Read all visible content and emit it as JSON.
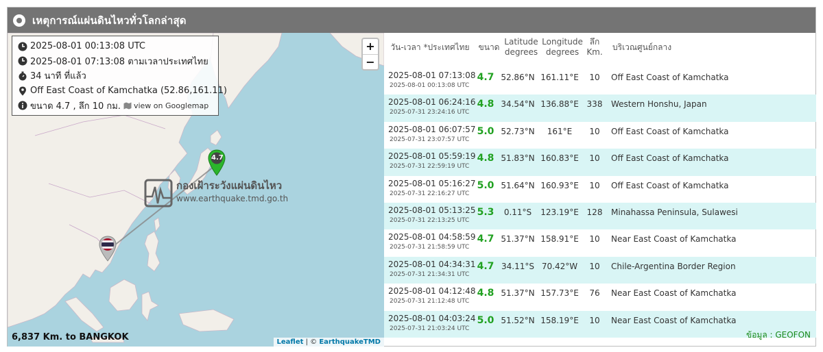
{
  "header": {
    "title": "เหตุการณ์แผ่นดินไหวทั่วโลกล่าสุด"
  },
  "info": {
    "utc": "2025-08-01 00:13:08 UTC",
    "thai_time": "2025-08-01 07:13:08 ตามเวลาประเทศไทย",
    "ago": "34 นาที ที่แล้ว",
    "location": "Off East Coast of Kamchatka (52.86,161.11)",
    "magnitude_depth": "ขนาด 4.7 , ลึก 10 กม.",
    "googlemap_link": "view on Googlemap"
  },
  "map": {
    "zoom_in": "+",
    "zoom_out": "−",
    "marker_mag": "4.7",
    "watermark_title": "กองเฝ้าระวังแผ่นดินไหว",
    "watermark_url": "www.earthquake.tmd.go.th",
    "distance": "6,837 Km. to BANGKOK",
    "attribution_leaflet": "Leaflet",
    "attribution_sep": " | © ",
    "attribution_tmd": "EarthquakeTMD"
  },
  "table": {
    "headers": {
      "datetime": "วัน-เวลา *ประเทศไทย",
      "magnitude": "ขนาด",
      "latitude": "Latitude degrees",
      "longitude": "Longitude degrees",
      "depth": "ลึก Km.",
      "region": "บริเวณศูนย์กลาง"
    },
    "rows": [
      {
        "dt": "2025-08-01 07:13:08",
        "utc": "2025-08-01 00:13:08 UTC",
        "mag": "4.7",
        "lat": "52.86°N",
        "lon": "161.11°E",
        "dep": "10",
        "reg": "Off East Coast of Kamchatka"
      },
      {
        "dt": "2025-08-01 06:24:16",
        "utc": "2025-07-31 23:24:16 UTC",
        "mag": "4.8",
        "lat": "34.54°N",
        "lon": "136.88°E",
        "dep": "338",
        "reg": "Western Honshu, Japan"
      },
      {
        "dt": "2025-08-01 06:07:57",
        "utc": "2025-07-31 23:07:57 UTC",
        "mag": "5.0",
        "lat": "52.73°N",
        "lon": "161°E",
        "dep": "10",
        "reg": "Off East Coast of Kamchatka"
      },
      {
        "dt": "2025-08-01 05:59:19",
        "utc": "2025-07-31 22:59:19 UTC",
        "mag": "4.8",
        "lat": "51.83°N",
        "lon": "160.83°E",
        "dep": "10",
        "reg": "Off East Coast of Kamchatka"
      },
      {
        "dt": "2025-08-01 05:16:27",
        "utc": "2025-07-31 22:16:27 UTC",
        "mag": "5.0",
        "lat": "51.64°N",
        "lon": "160.93°E",
        "dep": "10",
        "reg": "Off East Coast of Kamchatka"
      },
      {
        "dt": "2025-08-01 05:13:25",
        "utc": "2025-07-31 22:13:25 UTC",
        "mag": "5.3",
        "lat": "0.11°S",
        "lon": "123.19°E",
        "dep": "128",
        "reg": "Minahassa Peninsula, Sulawesi"
      },
      {
        "dt": "2025-08-01 04:58:59",
        "utc": "2025-07-31 21:58:59 UTC",
        "mag": "4.7",
        "lat": "51.37°N",
        "lon": "158.91°E",
        "dep": "10",
        "reg": "Near East Coast of Kamchatka"
      },
      {
        "dt": "2025-08-01 04:34:31",
        "utc": "2025-07-31 21:34:31 UTC",
        "mag": "4.7",
        "lat": "34.11°S",
        "lon": "70.42°W",
        "dep": "10",
        "reg": "Chile-Argentina Border Region"
      },
      {
        "dt": "2025-08-01 04:12:48",
        "utc": "2025-07-31 21:12:48 UTC",
        "mag": "4.8",
        "lat": "51.37°N",
        "lon": "157.73°E",
        "dep": "76",
        "reg": "Near East Coast of Kamchatka"
      },
      {
        "dt": "2025-08-01 04:03:24",
        "utc": "2025-07-31 21:03:24 UTC",
        "mag": "5.0",
        "lat": "51.52°N",
        "lon": "158.19°E",
        "dep": "10",
        "reg": "Near East Coast of Kamchatka"
      }
    ],
    "source": "ข้อมูล : GEOFON"
  },
  "colors": {
    "titlebar": "#747474",
    "magnitude_green": "#21a121",
    "alt_row": "#d9f5f5",
    "ocean": "#aad3df",
    "land": "#f2efe9"
  },
  "icons": [
    "clock-icon",
    "stopwatch-icon",
    "map-pin-icon",
    "info-icon",
    "map-icon",
    "earthquake-marker-icon",
    "thailand-flag-marker-icon"
  ]
}
